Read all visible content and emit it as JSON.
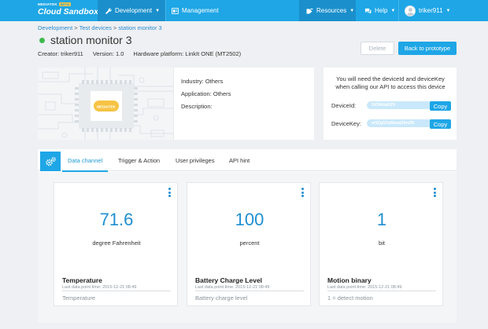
{
  "brand": {
    "sup": "MEDIATEK",
    "badge": "BETA",
    "main": "Cloud Sandbox"
  },
  "nav": {
    "development": "Development",
    "management": "Management",
    "resources": "Resources",
    "help": "Help",
    "user": "triker911"
  },
  "breadcrumb": [
    "Development",
    "Test devices",
    "station monitor 3"
  ],
  "device": {
    "name": "station monitor 3",
    "status_color": "#3fba4e",
    "creator": "Creator: triker911",
    "version": "Version: 1.0",
    "hardware": "Hardware platform: LinkIt ONE (MT2502)",
    "board_logo": "MEDIATEK"
  },
  "buttons": {
    "delete": "Delete",
    "back": "Back to prototype",
    "copy": "Copy"
  },
  "info": {
    "industry": "Industry: Others",
    "application": "Application: Others",
    "description": "Description:"
  },
  "keys": {
    "note": "You will need the deviceId and deviceKey when calling our API to access this device",
    "device_id_label": "DeviceId:",
    "device_id_value": "DOWdaH2V",
    "device_key_label": "DeviceKey:",
    "device_key_value": "uHZg0ZaWawj2fm2B"
  },
  "tabs": [
    {
      "label": "Data channel"
    },
    {
      "label": "Trigger & Action"
    },
    {
      "label": "User privileges"
    },
    {
      "label": "API hint"
    }
  ],
  "channels": [
    {
      "value": "71.6",
      "unit": "degree Fahrenheit",
      "name": "Temperature",
      "time": "Last data point time: 2015-12-21 08:49",
      "desc": "Temperature"
    },
    {
      "value": "100",
      "unit": "percent",
      "name": "Battery Charge Level",
      "time": "Last data point time: 2015-12-21 08:49",
      "desc": "Battery charge level"
    },
    {
      "value": "1",
      "unit": "bit",
      "name": "Motion binary",
      "time": "Last data point time: 2015-12-21 08:49",
      "desc": "1 = detect motion"
    }
  ],
  "colors": {
    "accent": "#1ea6e6",
    "accent_dark": "#1a8fcc",
    "value": "#1e8fd0",
    "status_online": "#3fba4e"
  }
}
